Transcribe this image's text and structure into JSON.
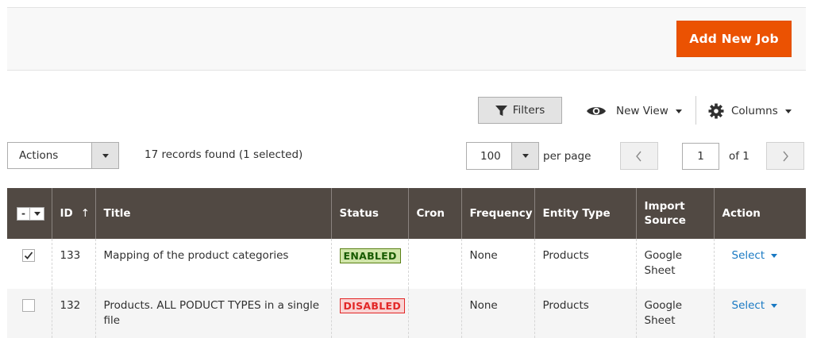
{
  "header": {
    "add_new_job_label": "Add New Job"
  },
  "toolbar": {
    "filters_label": "Filters",
    "view_label": "New View",
    "columns_label": "Columns",
    "actions_label": "Actions",
    "records_text": "17 records found (1 selected)",
    "per_page_value": "100",
    "per_page_label": "per page",
    "current_page": "1",
    "of_pages_label": "of 1"
  },
  "grid": {
    "columns": {
      "id": "ID",
      "sort_indicator": "↑",
      "title": "Title",
      "status": "Status",
      "cron": "Cron",
      "frequency": "Frequency",
      "entity_type": "Entity Type",
      "import_source": "Import Source",
      "action": "Action"
    },
    "mass_select_label": "-",
    "rows": [
      {
        "checked": true,
        "id": "133",
        "title": "Mapping of the product categories",
        "status": "ENABLED",
        "cron": "",
        "frequency": "None",
        "entity_type": "Products",
        "import_source": "Google Sheet",
        "action": "Select"
      },
      {
        "checked": false,
        "id": "132",
        "title": "Products. ALL PODUCT TYPES in a single file",
        "status": "DISABLED",
        "cron": "",
        "frequency": "None",
        "entity_type": "Products",
        "import_source": "Google Sheet",
        "action": "Select"
      }
    ]
  },
  "colors": {
    "accent": "#eb5202",
    "header_bg": "#514943",
    "link": "#1979c3",
    "enabled_bg": "#d0e5a9",
    "disabled_text": "#e22626"
  }
}
